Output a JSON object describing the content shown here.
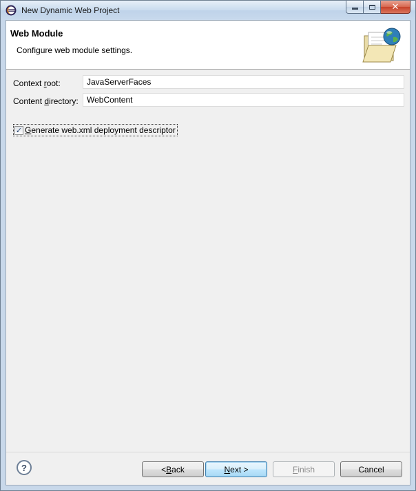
{
  "window": {
    "title": "New Dynamic Web Project",
    "app_icon": "eclipse-icon"
  },
  "header": {
    "title": "Web Module",
    "description": "Configure web module settings.",
    "banner_icon": "web-folder-globe-icon"
  },
  "form": {
    "context_root": {
      "label_pre": "Context ",
      "label_mnemonic": "r",
      "label_post": "oot:",
      "value": "JavaServerFaces"
    },
    "content_directory": {
      "label_pre": "Content ",
      "label_mnemonic": "d",
      "label_post": "irectory:",
      "value": "WebContent"
    },
    "generate_web_xml": {
      "label_mnemonic": "G",
      "label_post": "enerate web.xml deployment descriptor",
      "checked": true
    }
  },
  "footer": {
    "help_symbol": "?",
    "back": {
      "pre": "< ",
      "mnemonic": "B",
      "post": "ack"
    },
    "next": {
      "mnemonic": "N",
      "post": "ext >"
    },
    "finish": {
      "mnemonic": "F",
      "post": "inish",
      "enabled": false
    },
    "cancel": "Cancel"
  },
  "colors": {
    "title_bar": "#c9dbee",
    "dialog_background": "#f0f0f0",
    "default_button_border": "#3c7fb1",
    "close_button": "#c7422a"
  }
}
